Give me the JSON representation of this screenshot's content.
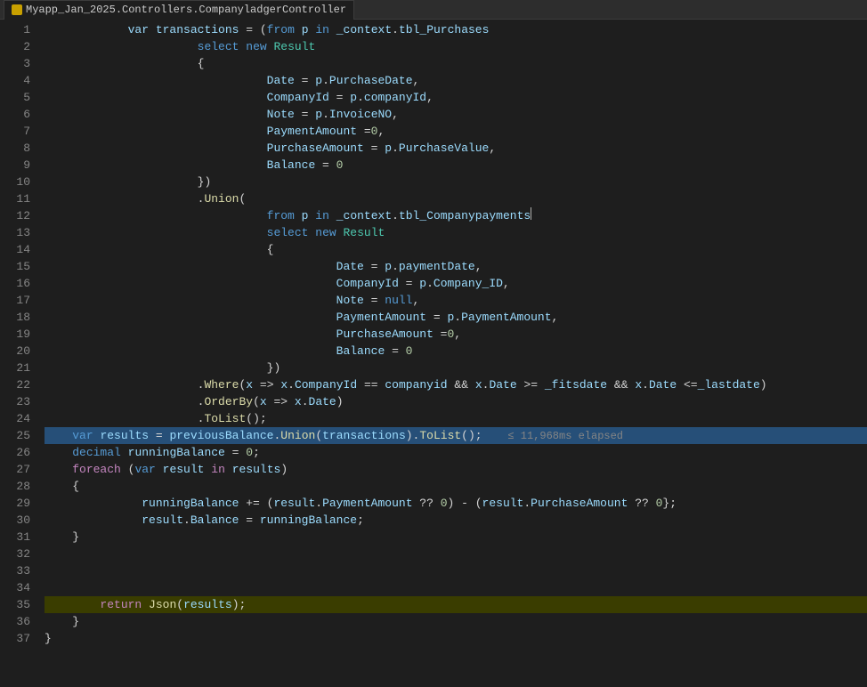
{
  "tab": {
    "title": "Myapp_Jan_2025.Controllers.CompanyladgerController",
    "icon_type": "controller"
  },
  "lines": [
    {
      "num": 1,
      "tokens": [
        {
          "t": "var-name",
          "v": "var transactions"
        },
        {
          "t": "punct",
          "v": " = ("
        },
        {
          "t": "linq",
          "v": "from"
        },
        {
          "t": "punct",
          "v": " "
        },
        {
          "t": "var-name",
          "v": "p"
        },
        {
          "t": "punct",
          "v": " "
        },
        {
          "t": "linq",
          "v": "in"
        },
        {
          "t": "punct",
          "v": " "
        },
        {
          "t": "var-name",
          "v": "_context"
        },
        {
          "t": "punct",
          "v": "."
        },
        {
          "t": "prop",
          "v": "tbl_Purchases"
        }
      ],
      "indent": 12
    },
    {
      "num": 2,
      "tokens": [
        {
          "t": "linq",
          "v": "select"
        },
        {
          "t": "punct",
          "v": " "
        },
        {
          "t": "kw",
          "v": "new"
        },
        {
          "t": "punct",
          "v": " "
        },
        {
          "t": "type",
          "v": "Result"
        }
      ],
      "indent": 22
    },
    {
      "num": 3,
      "tokens": [
        {
          "t": "punct",
          "v": "{"
        }
      ],
      "indent": 22
    },
    {
      "num": 4,
      "tokens": [
        {
          "t": "prop",
          "v": "Date"
        },
        {
          "t": "punct",
          "v": " = "
        },
        {
          "t": "var-name",
          "v": "p"
        },
        {
          "t": "punct",
          "v": "."
        },
        {
          "t": "prop",
          "v": "PurchaseDate"
        },
        {
          "t": "punct",
          "v": ","
        }
      ],
      "indent": 32
    },
    {
      "num": 5,
      "tokens": [
        {
          "t": "prop",
          "v": "CompanyId"
        },
        {
          "t": "punct",
          "v": " = "
        },
        {
          "t": "var-name",
          "v": "p"
        },
        {
          "t": "punct",
          "v": "."
        },
        {
          "t": "prop",
          "v": "companyId"
        },
        {
          "t": "punct",
          "v": ","
        }
      ],
      "indent": 32
    },
    {
      "num": 6,
      "tokens": [
        {
          "t": "prop",
          "v": "Note"
        },
        {
          "t": "punct",
          "v": " = "
        },
        {
          "t": "var-name",
          "v": "p"
        },
        {
          "t": "punct",
          "v": "."
        },
        {
          "t": "prop",
          "v": "InvoiceNO"
        },
        {
          "t": "punct",
          "v": ","
        }
      ],
      "indent": 32
    },
    {
      "num": 7,
      "tokens": [
        {
          "t": "prop",
          "v": "PaymentAmount"
        },
        {
          "t": "punct",
          "v": " ="
        },
        {
          "t": "num",
          "v": "0"
        },
        {
          "t": "punct",
          "v": ","
        }
      ],
      "indent": 32
    },
    {
      "num": 8,
      "tokens": [
        {
          "t": "prop",
          "v": "PurchaseAmount"
        },
        {
          "t": "punct",
          "v": " = "
        },
        {
          "t": "var-name",
          "v": "p"
        },
        {
          "t": "punct",
          "v": "."
        },
        {
          "t": "prop",
          "v": "PurchaseValue"
        },
        {
          "t": "punct",
          "v": ","
        }
      ],
      "indent": 32
    },
    {
      "num": 9,
      "tokens": [
        {
          "t": "prop",
          "v": "Balance"
        },
        {
          "t": "punct",
          "v": " = "
        },
        {
          "t": "num",
          "v": "0"
        }
      ],
      "indent": 32
    },
    {
      "num": 10,
      "tokens": [
        {
          "t": "punct",
          "v": "})"
        }
      ],
      "indent": 22
    },
    {
      "num": 11,
      "tokens": [
        {
          "t": "punct",
          "v": "."
        },
        {
          "t": "method",
          "v": "Union"
        },
        {
          "t": "punct",
          "v": "("
        }
      ],
      "indent": 22
    },
    {
      "num": 12,
      "tokens": [
        {
          "t": "linq",
          "v": "from"
        },
        {
          "t": "punct",
          "v": " "
        },
        {
          "t": "var-name",
          "v": "p"
        },
        {
          "t": "punct",
          "v": " "
        },
        {
          "t": "linq",
          "v": "in"
        },
        {
          "t": "punct",
          "v": " "
        },
        {
          "t": "var-name",
          "v": "_context"
        },
        {
          "t": "punct",
          "v": "."
        },
        {
          "t": "prop",
          "v": "tbl_Companypayments"
        }
      ],
      "indent": 32,
      "has_cursor": true,
      "cursor_after": true
    },
    {
      "num": 13,
      "tokens": [
        {
          "t": "linq",
          "v": "select"
        },
        {
          "t": "punct",
          "v": " "
        },
        {
          "t": "kw",
          "v": "new"
        },
        {
          "t": "punct",
          "v": " "
        },
        {
          "t": "type",
          "v": "Result"
        }
      ],
      "indent": 32
    },
    {
      "num": 14,
      "tokens": [
        {
          "t": "punct",
          "v": "{"
        }
      ],
      "indent": 32
    },
    {
      "num": 15,
      "tokens": [
        {
          "t": "prop",
          "v": "Date"
        },
        {
          "t": "punct",
          "v": " = "
        },
        {
          "t": "var-name",
          "v": "p"
        },
        {
          "t": "punct",
          "v": "."
        },
        {
          "t": "prop",
          "v": "paymentDate"
        },
        {
          "t": "punct",
          "v": ","
        }
      ],
      "indent": 42
    },
    {
      "num": 16,
      "tokens": [
        {
          "t": "prop",
          "v": "CompanyId"
        },
        {
          "t": "punct",
          "v": " = "
        },
        {
          "t": "var-name",
          "v": "p"
        },
        {
          "t": "punct",
          "v": "."
        },
        {
          "t": "prop",
          "v": "Company_ID"
        },
        {
          "t": "punct",
          "v": ","
        }
      ],
      "indent": 42
    },
    {
      "num": 17,
      "tokens": [
        {
          "t": "prop",
          "v": "Note"
        },
        {
          "t": "punct",
          "v": " = "
        },
        {
          "t": "kw",
          "v": "null"
        },
        {
          "t": "punct",
          "v": ","
        }
      ],
      "indent": 42
    },
    {
      "num": 18,
      "tokens": [
        {
          "t": "prop",
          "v": "PaymentAmount"
        },
        {
          "t": "punct",
          "v": " = "
        },
        {
          "t": "var-name",
          "v": "p"
        },
        {
          "t": "punct",
          "v": "."
        },
        {
          "t": "prop",
          "v": "PaymentAmount"
        },
        {
          "t": "punct",
          "v": ","
        }
      ],
      "indent": 42
    },
    {
      "num": 19,
      "tokens": [
        {
          "t": "prop",
          "v": "PurchaseAmount"
        },
        {
          "t": "punct",
          "v": " ="
        },
        {
          "t": "num",
          "v": "0"
        },
        {
          "t": "punct",
          "v": ","
        }
      ],
      "indent": 42
    },
    {
      "num": 20,
      "tokens": [
        {
          "t": "prop",
          "v": "Balance"
        },
        {
          "t": "punct",
          "v": " = "
        },
        {
          "t": "num",
          "v": "0"
        }
      ],
      "indent": 42
    },
    {
      "num": 21,
      "tokens": [
        {
          "t": "punct",
          "v": "})"
        }
      ],
      "indent": 32
    },
    {
      "num": 22,
      "tokens": [
        {
          "t": "punct",
          "v": "."
        },
        {
          "t": "method",
          "v": "Where"
        },
        {
          "t": "punct",
          "v": "("
        },
        {
          "t": "var-name",
          "v": "x"
        },
        {
          "t": "punct",
          "v": " => "
        },
        {
          "t": "var-name",
          "v": "x"
        },
        {
          "t": "punct",
          "v": "."
        },
        {
          "t": "prop",
          "v": "CompanyId"
        },
        {
          "t": "punct",
          "v": " == "
        },
        {
          "t": "var-name",
          "v": "companyid"
        },
        {
          "t": "punct",
          "v": " && "
        },
        {
          "t": "var-name",
          "v": "x"
        },
        {
          "t": "punct",
          "v": "."
        },
        {
          "t": "prop",
          "v": "Date"
        },
        {
          "t": "punct",
          "v": " >= "
        },
        {
          "t": "var-name",
          "v": "_fitsdate"
        },
        {
          "t": "punct",
          "v": " && "
        },
        {
          "t": "var-name",
          "v": "x"
        },
        {
          "t": "punct",
          "v": "."
        },
        {
          "t": "prop",
          "v": "Date"
        },
        {
          "t": "punct",
          "v": " <="
        },
        {
          "t": "var-name",
          "v": "_lastdate"
        },
        {
          "t": "punct",
          "v": ")"
        }
      ],
      "indent": 22
    },
    {
      "num": 23,
      "tokens": [
        {
          "t": "punct",
          "v": "."
        },
        {
          "t": "method",
          "v": "OrderBy"
        },
        {
          "t": "punct",
          "v": "("
        },
        {
          "t": "var-name",
          "v": "x"
        },
        {
          "t": "punct",
          "v": " => "
        },
        {
          "t": "var-name",
          "v": "x"
        },
        {
          "t": "punct",
          "v": "."
        },
        {
          "t": "prop",
          "v": "Date"
        },
        {
          "t": "punct",
          "v": ")"
        }
      ],
      "indent": 22
    },
    {
      "num": 24,
      "tokens": [
        {
          "t": "punct",
          "v": "."
        },
        {
          "t": "method",
          "v": "ToList"
        },
        {
          "t": "punct",
          "v": "();"
        }
      ],
      "indent": 22
    },
    {
      "num": 25,
      "tokens": [
        {
          "t": "kw",
          "v": "var"
        },
        {
          "t": "punct",
          "v": " "
        },
        {
          "t": "var-name",
          "v": "results"
        },
        {
          "t": "punct",
          "v": " = "
        },
        {
          "t": "var-name",
          "v": "previousBalance"
        },
        {
          "t": "punct",
          "v": "."
        },
        {
          "t": "method",
          "v": "Union"
        },
        {
          "t": "punct",
          "v": "("
        },
        {
          "t": "var-name",
          "v": "transactions"
        },
        {
          "t": "punct",
          "v": ")."
        },
        {
          "t": "method",
          "v": "ToList"
        },
        {
          "t": "punct",
          "v": "();"
        }
      ],
      "indent": 4,
      "highlighted": true,
      "elapsed": "≤ 11,968ms elapsed"
    },
    {
      "num": 26,
      "tokens": [
        {
          "t": "kw",
          "v": "decimal"
        },
        {
          "t": "punct",
          "v": " "
        },
        {
          "t": "var-name",
          "v": "runningBalance"
        },
        {
          "t": "punct",
          "v": " = "
        },
        {
          "t": "num",
          "v": "0"
        },
        {
          "t": "punct",
          "v": ";"
        }
      ],
      "indent": 4
    },
    {
      "num": 27,
      "tokens": [
        {
          "t": "kw2",
          "v": "foreach"
        },
        {
          "t": "punct",
          "v": " ("
        },
        {
          "t": "kw",
          "v": "var"
        },
        {
          "t": "punct",
          "v": " "
        },
        {
          "t": "var-name",
          "v": "result"
        },
        {
          "t": "punct",
          "v": " "
        },
        {
          "t": "kw2",
          "v": "in"
        },
        {
          "t": "punct",
          "v": " "
        },
        {
          "t": "var-name",
          "v": "results"
        },
        {
          "t": "punct",
          "v": ")"
        }
      ],
      "indent": 4
    },
    {
      "num": 28,
      "tokens": [
        {
          "t": "punct",
          "v": "{"
        }
      ],
      "indent": 4
    },
    {
      "num": 29,
      "tokens": [
        {
          "t": "var-name",
          "v": "runningBalance"
        },
        {
          "t": "punct",
          "v": " += ("
        },
        {
          "t": "var-name",
          "v": "result"
        },
        {
          "t": "punct",
          "v": "."
        },
        {
          "t": "prop",
          "v": "PaymentAmount"
        },
        {
          "t": "punct",
          "v": " ?? "
        },
        {
          "t": "num",
          "v": "0"
        },
        {
          "t": "punct",
          "v": ") - ("
        },
        {
          "t": "var-name",
          "v": "result"
        },
        {
          "t": "punct",
          "v": "."
        },
        {
          "t": "prop",
          "v": "PurchaseAmount"
        },
        {
          "t": "punct",
          "v": " ?? "
        },
        {
          "t": "num",
          "v": "0"
        },
        {
          "t": "punct",
          "v": "};"
        }
      ],
      "indent": 14
    },
    {
      "num": 30,
      "tokens": [
        {
          "t": "var-name",
          "v": "result"
        },
        {
          "t": "punct",
          "v": "."
        },
        {
          "t": "prop",
          "v": "Balance"
        },
        {
          "t": "punct",
          "v": " = "
        },
        {
          "t": "var-name",
          "v": "runningBalance"
        },
        {
          "t": "punct",
          "v": ";"
        }
      ],
      "indent": 14
    },
    {
      "num": 31,
      "tokens": [
        {
          "t": "punct",
          "v": "}"
        }
      ],
      "indent": 4
    },
    {
      "num": 32,
      "tokens": [],
      "indent": 0
    },
    {
      "num": 33,
      "tokens": [],
      "indent": 0
    },
    {
      "num": 34,
      "tokens": [],
      "indent": 0
    },
    {
      "num": 35,
      "tokens": [
        {
          "t": "kw2",
          "v": "return"
        },
        {
          "t": "punct",
          "v": " "
        },
        {
          "t": "method",
          "v": "Json"
        },
        {
          "t": "punct",
          "v": "("
        },
        {
          "t": "var-name",
          "v": "results"
        },
        {
          "t": "punct",
          "v": ");"
        }
      ],
      "indent": 8,
      "highlighted_green": true
    },
    {
      "num": 36,
      "tokens": [
        {
          "t": "punct",
          "v": "}"
        }
      ],
      "indent": 4
    },
    {
      "num": 37,
      "tokens": [
        {
          "t": "punct",
          "v": "}"
        }
      ],
      "indent": 0
    }
  ]
}
